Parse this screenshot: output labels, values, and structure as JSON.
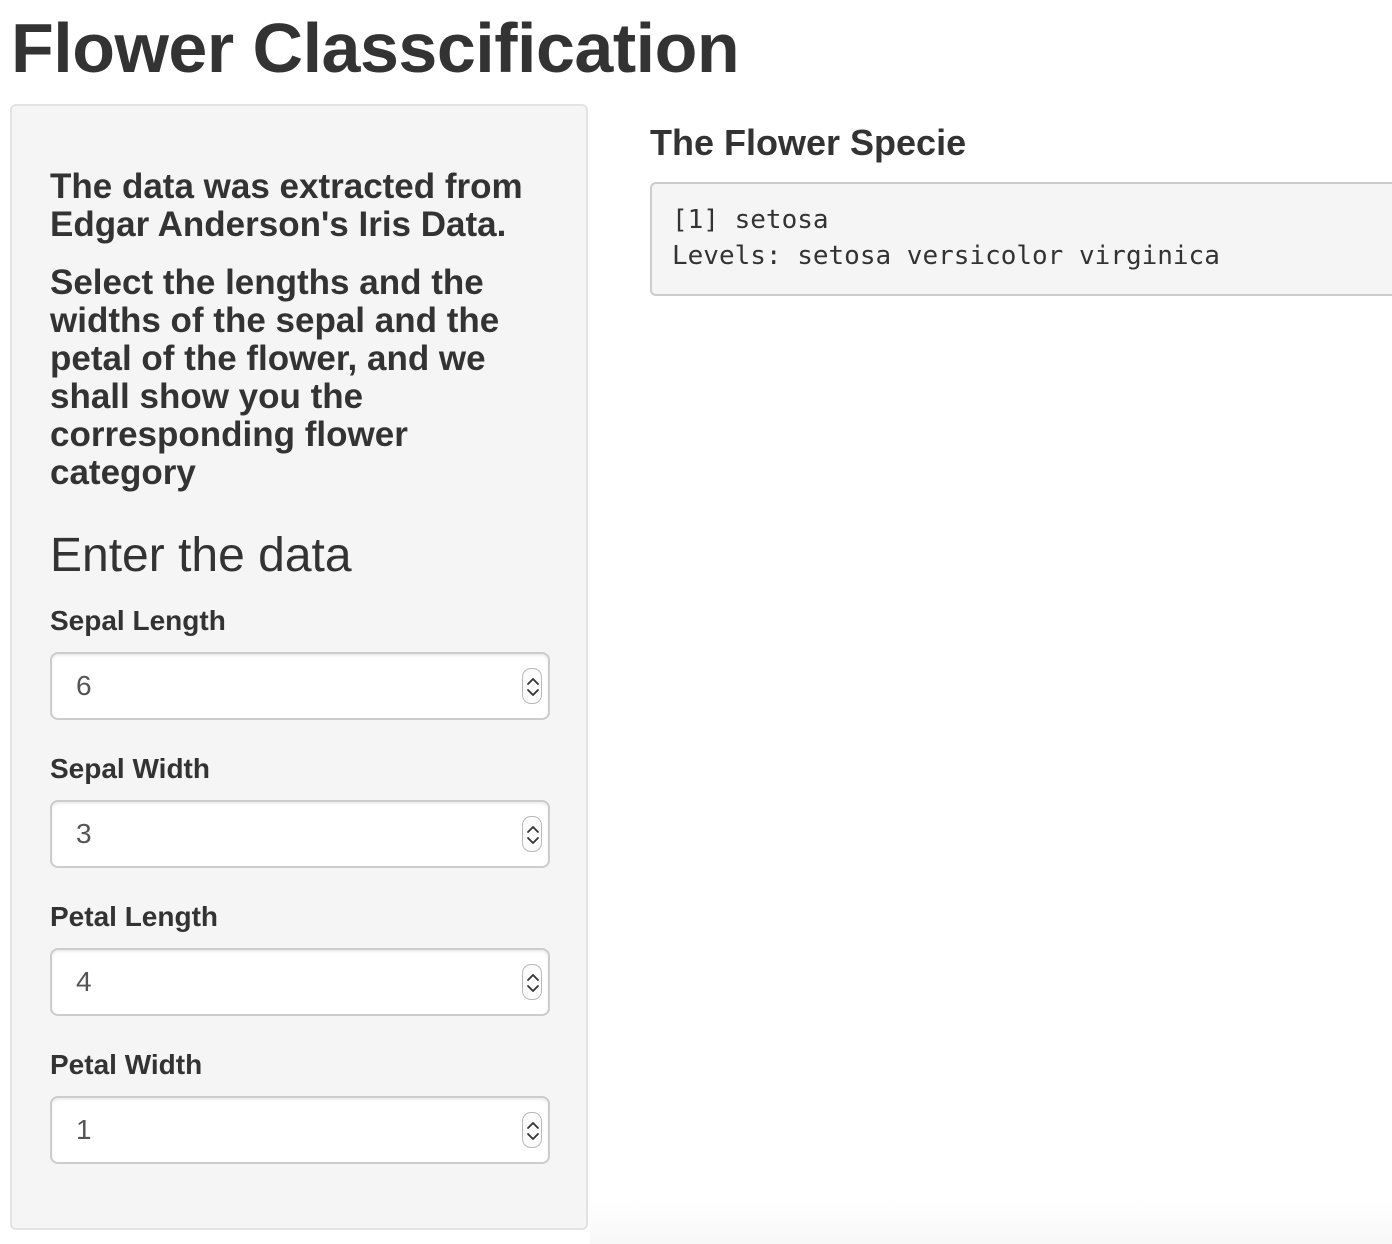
{
  "page": {
    "title": "Flower Classcification"
  },
  "sidebar": {
    "intro_1": "The data was extracted from Edgar Anderson's Iris Data.",
    "intro_2": "Select the lengths and the widths of the sepal and the petal of the flower, and we shall show you the corresponding flower category",
    "section_heading": "Enter the data",
    "fields": [
      {
        "label": "Sepal Length",
        "value": "6"
      },
      {
        "label": "Sepal Width",
        "value": "3"
      },
      {
        "label": "Petal Length",
        "value": "4"
      },
      {
        "label": "Petal Width",
        "value": "1"
      }
    ]
  },
  "main": {
    "heading": "The Flower Specie",
    "output_lines": [
      "[1] setosa",
      "Levels: setosa versicolor virginica"
    ]
  },
  "icons": {
    "stepper": "spinner-up-down-icon"
  }
}
